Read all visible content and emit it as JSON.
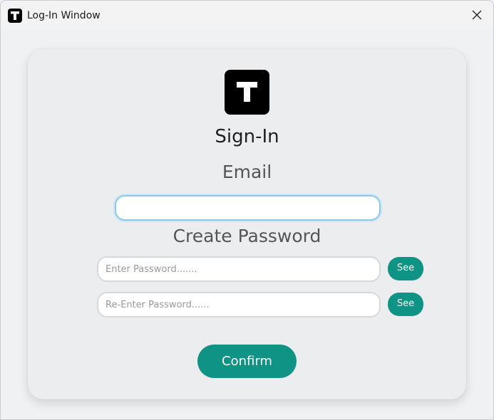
{
  "window": {
    "title": "Log-In Window",
    "app_icon": "T",
    "close_icon": "close-icon"
  },
  "form": {
    "logo_letter": "T",
    "heading": "Sign-In",
    "email_label": "Email",
    "email_value": "",
    "password_label": "Create Password",
    "password_placeholder": "Enter Password.......",
    "reenter_placeholder": "Re-Enter Password......",
    "see_label": "See",
    "confirm_label": "Confirm"
  },
  "colors": {
    "accent": "#0f9384",
    "logo_bg": "#000000",
    "focus_border": "#8fc9e9"
  }
}
